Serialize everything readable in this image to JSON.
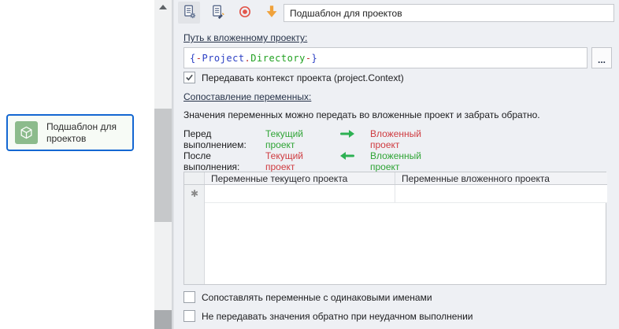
{
  "colors": {
    "accent_blue": "#1467d2",
    "panel_bg": "#eef0f4",
    "green_text": "#2fa435",
    "red_text": "#cf3b40",
    "arrow_green": "#2db153",
    "icon_green_bg": "#8cbb8c",
    "record_red": "#e2574c",
    "arrow_orange": "#f0a23b"
  },
  "left_panel": {
    "selected_item": {
      "title": "Подшаблон для проектов",
      "icon": "cube-icon"
    }
  },
  "toolbar": {
    "buttons": [
      {
        "name": "properties-document",
        "icon": "document-gear-icon",
        "pressed": true
      },
      {
        "name": "edit-document",
        "icon": "document-pencil-icon",
        "pressed": false
      },
      {
        "name": "record",
        "icon": "record-icon",
        "pressed": false
      },
      {
        "name": "move-down",
        "icon": "down-arrow-icon",
        "pressed": false
      }
    ],
    "title_value": "Подшаблон для проектов"
  },
  "form": {
    "path_link": "Путь к вложенному проекту:",
    "path_segments": [
      {
        "text": "{",
        "color": "#2b3fc4"
      },
      {
        "text": "-",
        "color": "#c23838"
      },
      {
        "text": "Project",
        "color": "#2b3fc4"
      },
      {
        "text": ".",
        "color": "#c23838"
      },
      {
        "text": "Directory",
        "color": "#21a121"
      },
      {
        "text": "-",
        "color": "#c23838"
      },
      {
        "text": "}",
        "color": "#2b3fc4"
      }
    ],
    "browse_label": "...",
    "context_checkbox": {
      "label": "Передавать контекст проекта (project.Context)",
      "checked": true
    },
    "mapping_link": "Сопоставление переменных:",
    "mapping_description": "Значения переменных можно передать во вложенные проект и забрать обратно.",
    "before_row": {
      "label": "Перед выполнением:",
      "from": "Текущий проект",
      "to": "Вложенный проект",
      "direction": "right"
    },
    "after_row": {
      "label": "После выполнения:",
      "from": "Текущий проект",
      "to": "Вложенный проект",
      "direction": "left"
    },
    "table": {
      "headers": [
        "Переменные текущего проекта",
        "Переменные вложенного проекта"
      ],
      "new_row_marker": "✱",
      "rows": []
    },
    "match_names_checkbox": {
      "label": "Сопоставлять переменные с одинаковыми именами",
      "checked": false
    },
    "no_return_checkbox": {
      "label": "Не передавать значения обратно при неудачном выполнении",
      "checked": false
    }
  }
}
